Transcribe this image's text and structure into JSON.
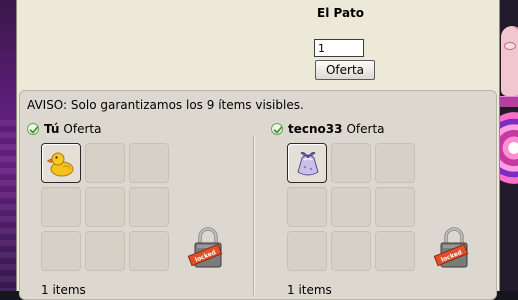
{
  "window": {
    "item_name": "El Pato",
    "amount_value": "1",
    "offer_button_label": "Oferta"
  },
  "trade": {
    "warning": "AVISO: Solo garantizamos los 9 ítems visibles.",
    "you": {
      "name": "Tú",
      "offer_label": "Oferta",
      "items": [
        "rubber-duck-icon"
      ],
      "count_label": "1 items"
    },
    "partner": {
      "name": "tecno33",
      "offer_label": "Oferta",
      "items": [
        "gift-bag-icon"
      ],
      "count_label": "1 items"
    },
    "lock_badge_text": "locked"
  },
  "colors": {
    "window_bg": "#ece9d8",
    "panel_bg": "#ddd8cf",
    "check_green": "#3c9a2a",
    "lock_ribbon": "#e0502a"
  }
}
